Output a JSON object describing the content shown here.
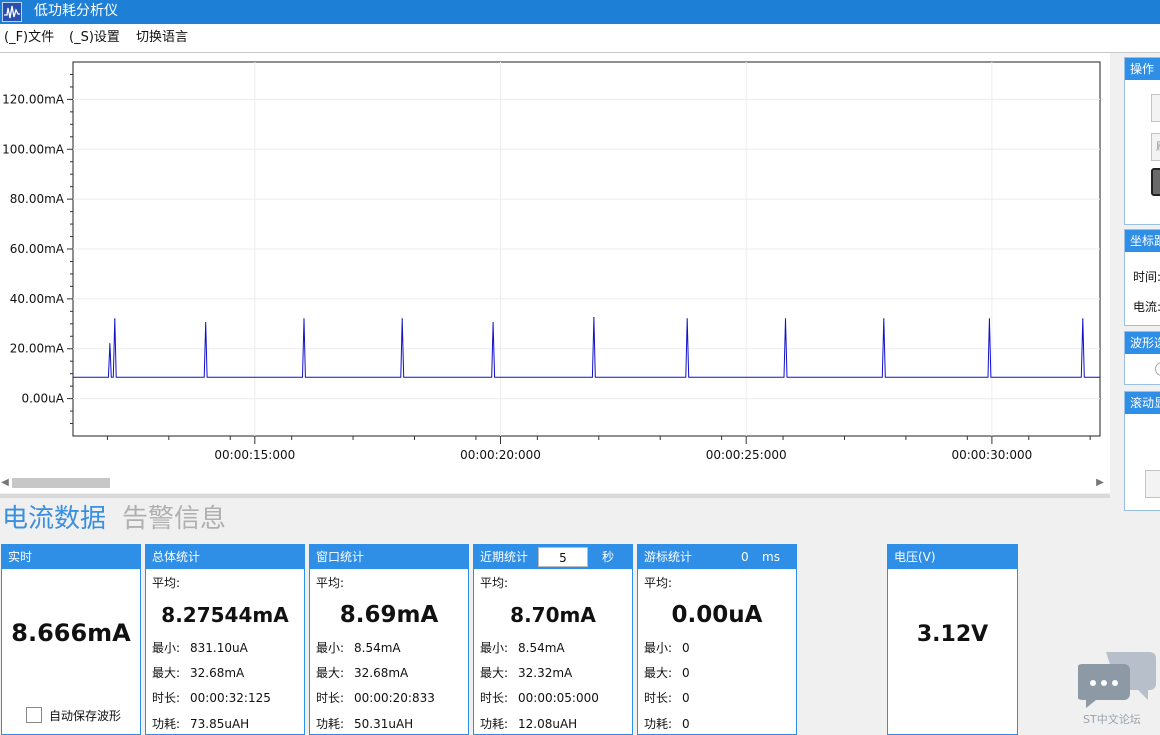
{
  "window": {
    "title": "低功耗分析仪"
  },
  "menu": {
    "file": "(_F)文件",
    "settings": "(_S)设置",
    "language": "切换语言"
  },
  "chart_data": {
    "type": "line",
    "y_ticks": [
      "120.00mA",
      "100.00mA",
      "80.00mA",
      "60.00mA",
      "40.00mA",
      "20.00mA",
      "0.00uA"
    ],
    "x_ticks": [
      "00:00:15:000",
      "00:00:20:000",
      "00:00:25:000",
      "00:00:30:000"
    ],
    "x_range_s": [
      11.3,
      32.2
    ],
    "ylim_mA": [
      -15,
      135
    ],
    "baseline_mA": 8.6,
    "peaks": [
      {
        "t": 12.05,
        "mA": 22.0
      },
      {
        "t": 12.15,
        "mA": 32.0
      },
      {
        "t": 14.0,
        "mA": 30.5
      },
      {
        "t": 16.0,
        "mA": 32.0
      },
      {
        "t": 18.0,
        "mA": 32.0
      },
      {
        "t": 19.85,
        "mA": 30.5
      },
      {
        "t": 21.9,
        "mA": 32.5
      },
      {
        "t": 23.8,
        "mA": 32.0
      },
      {
        "t": 25.8,
        "mA": 32.0
      },
      {
        "t": 27.8,
        "mA": 32.0
      },
      {
        "t": 29.95,
        "mA": 32.0
      },
      {
        "t": 31.85,
        "mA": 32.0
      }
    ],
    "line_color": "#1010c8",
    "grid": true
  },
  "right_panel": {
    "ops_title": "操作",
    "ops_btn_text": "刷",
    "coord_title": "坐标跟",
    "time_label": "时间:",
    "current_label": "电流:",
    "wave_title": "波形选",
    "scroll_title": "滚动显"
  },
  "tabs": {
    "current_data": "电流数据",
    "alarm_info": "告警信息"
  },
  "realtime": {
    "title": "实时",
    "value": "8.666mA",
    "autosave_label": "自动保存波形"
  },
  "total": {
    "title": "总体统计",
    "avg_label": "平均:",
    "avg": "8.27544mA",
    "min_label": "最小:",
    "min": "831.10uA",
    "max_label": "最大:",
    "max": "32.68mA",
    "dur_label": "时长:",
    "duration": "00:00:32:125",
    "power_label": "功耗:",
    "power": "73.85uAH"
  },
  "window_stats": {
    "title": "窗口统计",
    "avg_label": "平均:",
    "avg": "8.69mA",
    "min_label": "最小:",
    "min": "8.54mA",
    "max_label": "最大:",
    "max": "32.68mA",
    "dur_label": "时长:",
    "duration": "00:00:20:833",
    "power_label": "功耗:",
    "power": "50.31uAH"
  },
  "recent": {
    "title": "近期统计",
    "seconds": "5",
    "sec_unit": "秒",
    "avg_label": "平均:",
    "avg": "8.70mA",
    "min_label": "最小:",
    "min": "8.54mA",
    "max_label": "最大:",
    "max": "32.32mA",
    "dur_label": "时长:",
    "duration": "00:00:05:000",
    "power_label": "功耗:",
    "power": "12.08uAH"
  },
  "cursor": {
    "title": "游标统计",
    "ms_value": "0",
    "ms_unit": "ms",
    "avg_label": "平均:",
    "avg": "0.00uA",
    "min_label": "最小:",
    "min": "0",
    "max_label": "最大:",
    "max": "0",
    "dur_label": "时长:",
    "duration": "0",
    "power_label": "功耗:",
    "power": "0"
  },
  "voltage": {
    "title": "电压(V)",
    "value": "3.12V"
  },
  "watermark": {
    "text": "ST中文论坛"
  }
}
